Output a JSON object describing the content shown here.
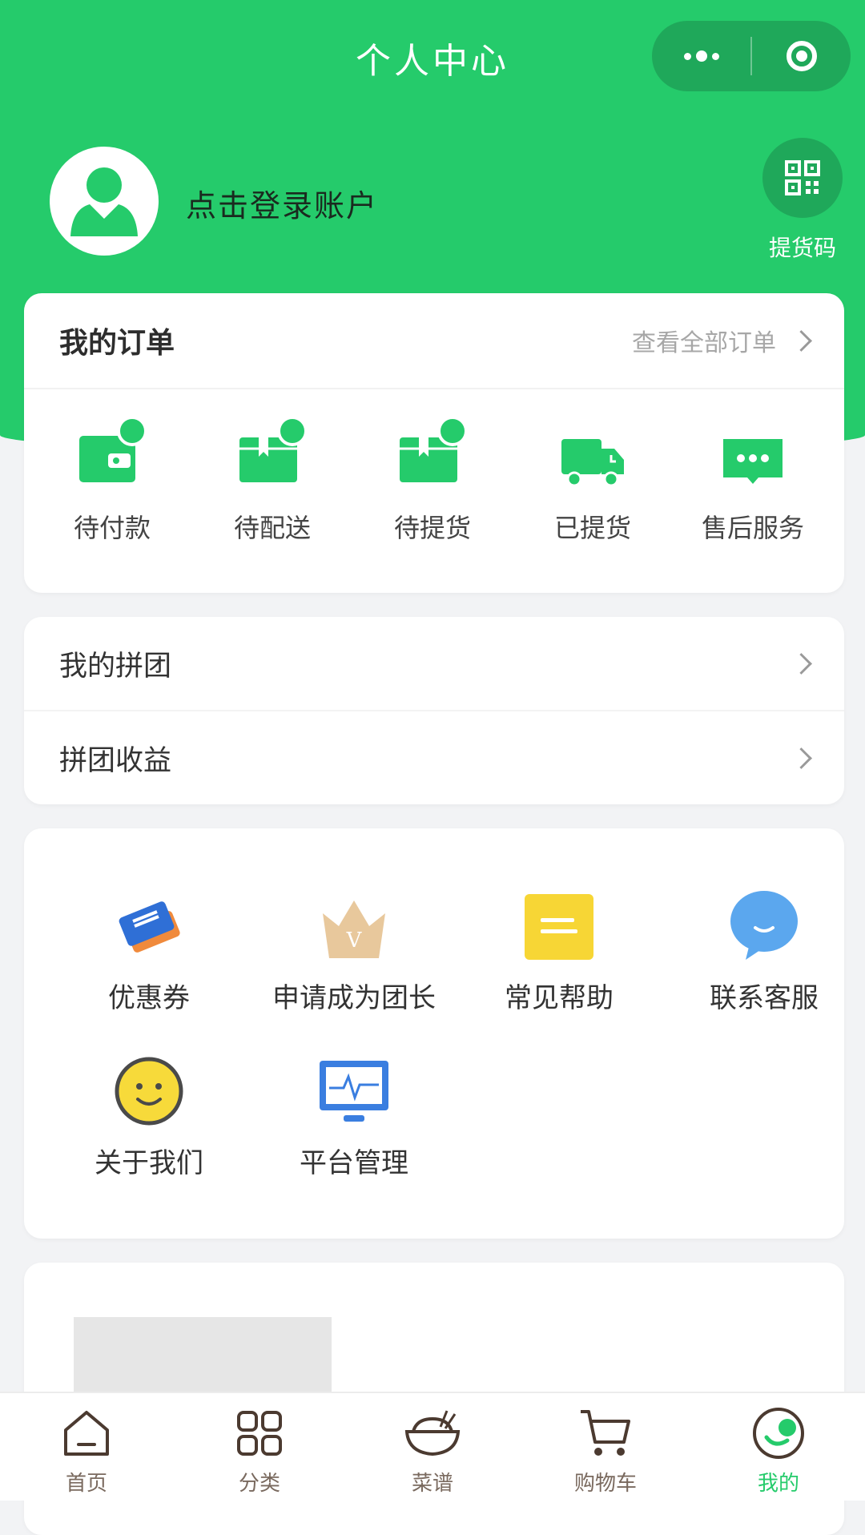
{
  "colors": {
    "brand_green": "#25cb6b",
    "dark_green": "#1fa85a",
    "page_bg": "#f2f3f5"
  },
  "nav": {
    "title": "个人中心",
    "menu_icon": "more-dots-icon",
    "close_icon": "target-circle-icon"
  },
  "profile": {
    "login_text": "点击登录账户",
    "avatar_icon": "user-avatar-icon",
    "qr_label": "提货码",
    "qr_icon": "qrcode-icon"
  },
  "orders": {
    "title": "我的订单",
    "view_all": "查看全部订单",
    "items": [
      {
        "label": "待付款",
        "icon": "wallet-icon"
      },
      {
        "label": "待配送",
        "icon": "package-icon"
      },
      {
        "label": "待提货",
        "icon": "package-pickup-icon"
      },
      {
        "label": "已提货",
        "icon": "truck-icon"
      },
      {
        "label": "售后服务",
        "icon": "chat-bubble-icon"
      }
    ]
  },
  "group": {
    "items": [
      {
        "label": "我的拼团"
      },
      {
        "label": "拼团收益"
      }
    ]
  },
  "tools": {
    "items": [
      {
        "label": "优惠券",
        "icon": "coupon-icon"
      },
      {
        "label": "申请成为团长",
        "icon": "crown-icon"
      },
      {
        "label": "常见帮助",
        "icon": "help-note-icon"
      },
      {
        "label": "联系客服",
        "icon": "customer-service-icon"
      },
      {
        "label": "关于我们",
        "icon": "smiley-icon"
      },
      {
        "label": "平台管理",
        "icon": "monitor-icon"
      }
    ]
  },
  "tabbar": {
    "active": "我的",
    "items": [
      {
        "label": "首页",
        "icon": "home-icon"
      },
      {
        "label": "分类",
        "icon": "grid-icon"
      },
      {
        "label": "菜谱",
        "icon": "rice-bowl-icon"
      },
      {
        "label": "购物车",
        "icon": "cart-icon"
      },
      {
        "label": "我的",
        "icon": "profile-icon"
      }
    ]
  }
}
